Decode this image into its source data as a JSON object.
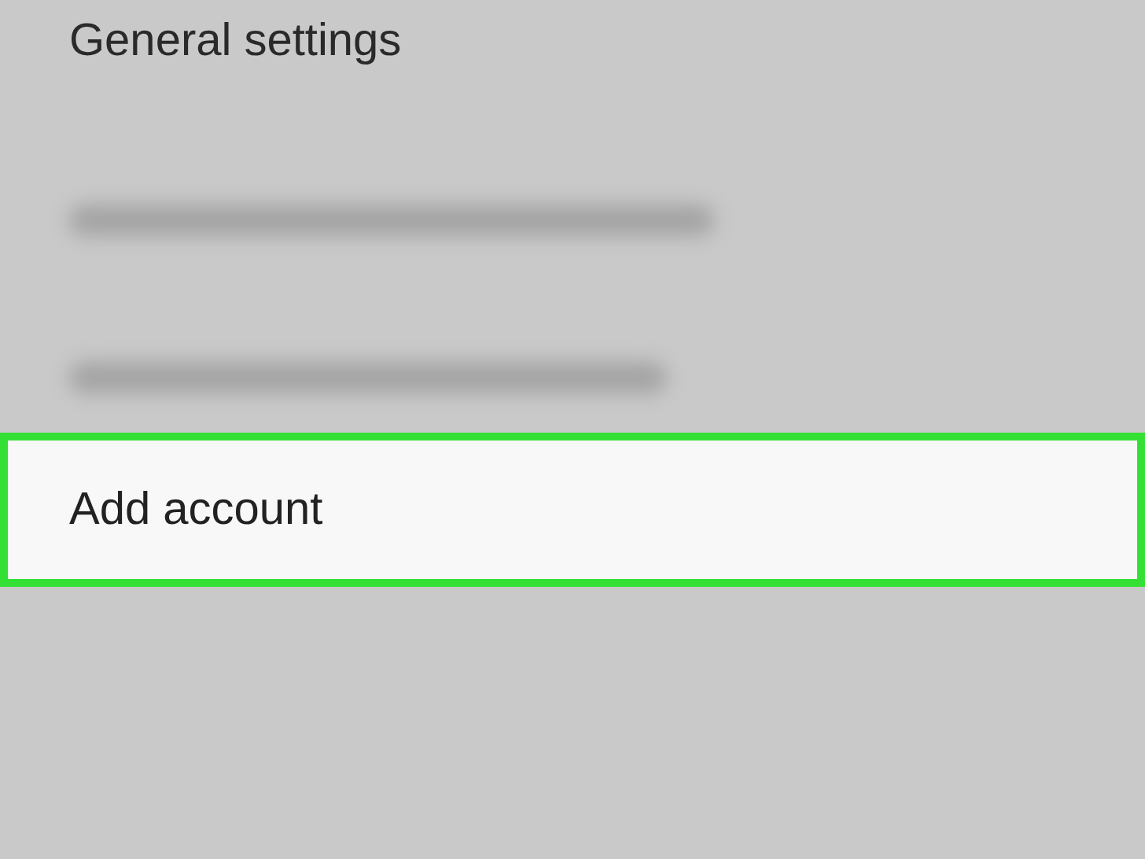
{
  "header": {
    "title": "General settings"
  },
  "items": [
    {
      "kind": "blurred"
    },
    {
      "kind": "blurred"
    },
    {
      "kind": "action",
      "label": "Add account",
      "highlighted": true
    }
  ]
}
